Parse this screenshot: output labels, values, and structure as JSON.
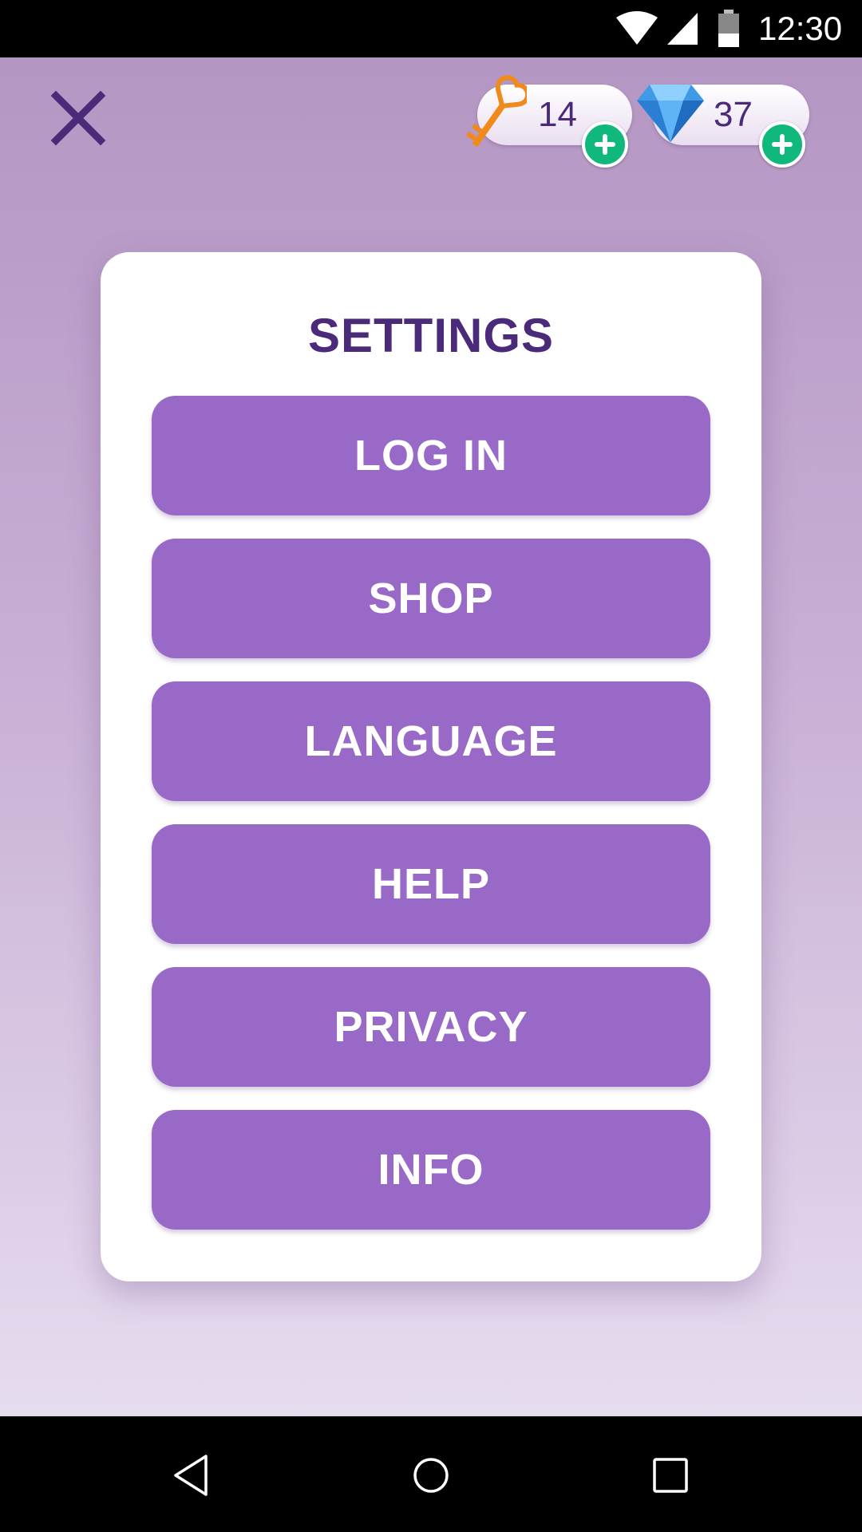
{
  "status_bar": {
    "time": "12:30",
    "icons": [
      "wifi-icon",
      "cell-signal-icon",
      "battery-icon"
    ]
  },
  "header": {
    "close_icon": "close-icon",
    "currencies": [
      {
        "name": "keys",
        "icon": "key-icon",
        "value": "14",
        "add_icon": "plus-icon"
      },
      {
        "name": "gems",
        "icon": "diamond-icon",
        "value": "37",
        "add_icon": "plus-icon"
      }
    ]
  },
  "settings": {
    "title": "SETTINGS",
    "buttons": [
      {
        "label": "LOG IN"
      },
      {
        "label": "SHOP"
      },
      {
        "label": "LANGUAGE"
      },
      {
        "label": "HELP"
      },
      {
        "label": "PRIVACY"
      },
      {
        "label": "INFO"
      }
    ]
  },
  "nav_bar": {
    "icons": [
      "back-icon",
      "home-icon",
      "recents-icon"
    ]
  },
  "colors": {
    "accent": "#9869c6",
    "title": "#4b2a7a",
    "plus": "#10b97b",
    "background_top": "#b496c2",
    "background_bottom": "#e6dcef"
  }
}
